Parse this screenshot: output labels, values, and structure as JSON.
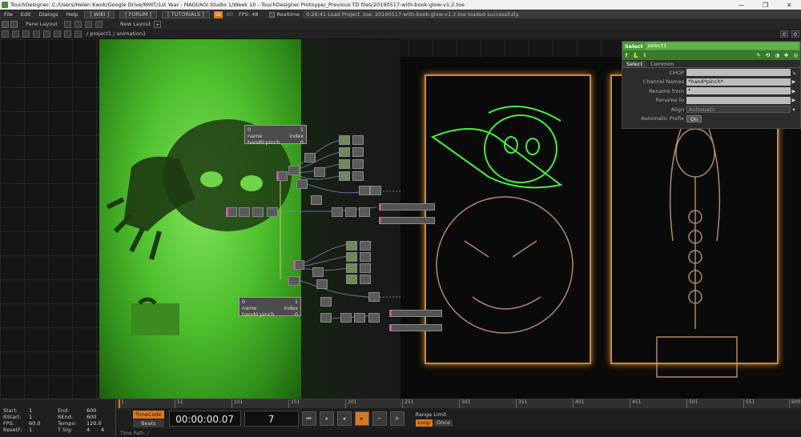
{
  "window": {
    "title": "TouchDesigner: C:/Users/Helen Kwok/Google Drive/RMIT/1st Year - MAGI/AGI Studio 1/Week 10 - TouchDesigner Protoype/_Previous TD files/20190517-with-book-glow-v1.2.toe",
    "min": "—",
    "max": "❐",
    "close": "✕"
  },
  "menu": {
    "items": [
      "File",
      "Edit",
      "Dialogs",
      "Help"
    ],
    "wiki": "[ WIKI ]",
    "forum": "[ FORUM ]",
    "tutorials": "[ TUTORIALS ]",
    "oi": "OI",
    "sixty": "60",
    "fps": "FPS: 48",
    "realtime": "Realtime",
    "status": "0:26:41 Load Project .toe: 20190517-with-book-glow-v1.2.toe loaded successfully."
  },
  "panebar": {
    "pane_layout": "Pane Layout",
    "new_layout": "New Layout",
    "plus": "+"
  },
  "pathbar": {
    "path": "/ project1 / animation1",
    "z1": "0",
    "z2": "0"
  },
  "params": {
    "kind": "Select",
    "op_name": "select1",
    "help": "?",
    "info": "i",
    "tabs": [
      "Select",
      "Common"
    ],
    "rows": [
      {
        "label": "CHOP",
        "value": ""
      },
      {
        "label": "Channel Names",
        "value": "*hand*pinch*"
      },
      {
        "label": "Rename from",
        "value": "*"
      },
      {
        "label": "Rename to",
        "value": ""
      },
      {
        "label": "Align",
        "value": "Automatic"
      },
      {
        "label": "Automatic Prefix",
        "value": "On"
      }
    ]
  },
  "network": {
    "node_top_a": "0",
    "node_top_b": "1",
    "node_top_name": "name",
    "node_top_index": "index",
    "node_top_chan": "hand0:pinch",
    "node_top_chan_val": "0",
    "node_bot_a": "0",
    "node_bot_b": "1",
    "node_bot_name": "name",
    "node_bot_index": "index",
    "node_bot_chan": "hand0:pinch",
    "node_bot_chan_val": "0"
  },
  "ruler": {
    "ticks": [
      "1",
      "51",
      "101",
      "151",
      "201",
      "251",
      "301",
      "351",
      "401",
      "451",
      "501",
      "551",
      "600"
    ]
  },
  "info": {
    "start_l": "Start:",
    "start_v": "1",
    "end_l": "End:",
    "end_v": "600",
    "rstart_l": "RStart:",
    "rstart_v": "1",
    "rend_l": "REnd:",
    "rend_v": "600",
    "fps_l": "FPS:",
    "fps_v": "60.0",
    "tempo_l": "Tempo:",
    "tempo_v": "120.0",
    "resetf_l": "ResetF:",
    "resetf_v": "1",
    "tsig_l": "T Sig:",
    "tsig_v1": "4",
    "tsig_v2": "4"
  },
  "transport": {
    "timecode_label": "TimeCode",
    "beats_label": "Beats",
    "timecode": "00:00:00.07",
    "frame": "7",
    "range_limit": "Range Limit",
    "loop": "Loop",
    "once": "Once",
    "b_rewind": "⏮",
    "b_pause": "⏸",
    "b_back": "◂",
    "b_play": "▸",
    "b_minus": "−",
    "b_plus": "+"
  },
  "timepath": "Time Path: /",
  "colors": {
    "accent": "#d8781f",
    "select_green": "#4a9a3a",
    "glow": "#c78a3c"
  }
}
